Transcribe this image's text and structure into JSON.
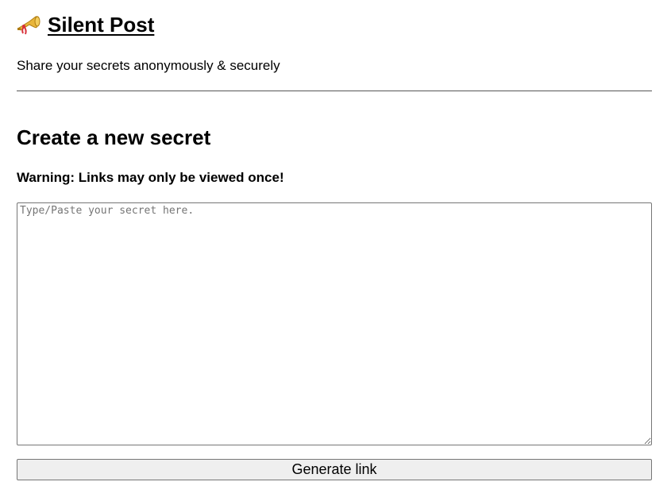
{
  "header": {
    "title": "Silent Post",
    "logo_icon": "postal-horn-icon",
    "tagline": "Share your secrets anonymously & securely"
  },
  "main": {
    "heading": "Create a new secret",
    "warning": "Warning: Links may only be viewed once!",
    "secret_input": {
      "value": "",
      "placeholder": "Type/Paste your secret here."
    },
    "generate_button_label": "Generate link"
  },
  "colors": {
    "text": "#000000",
    "divider": "#555555",
    "input_border": "#767676",
    "placeholder": "#757575",
    "button_background": "#efefef",
    "horn_gold": "#e8b53a",
    "horn_red": "#d8303a"
  }
}
